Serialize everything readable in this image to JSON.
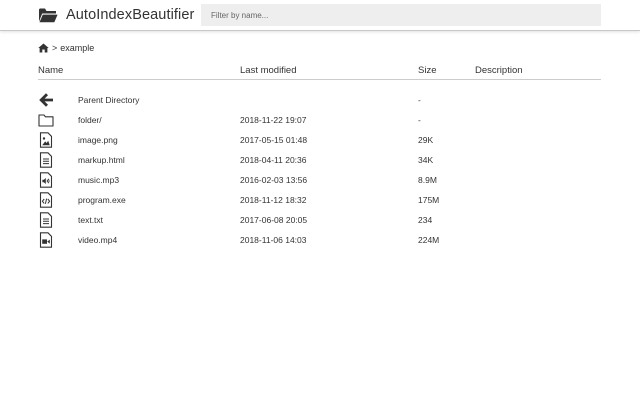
{
  "app": {
    "title": "AutoIndexBeautifier",
    "icon": "folder-open-icon"
  },
  "search": {
    "placeholder": "Filter by name..."
  },
  "breadcrumb": {
    "home_icon": "home-icon",
    "separator": ">",
    "current": "example"
  },
  "table": {
    "headers": {
      "name": "Name",
      "modified": "Last modified",
      "size": "Size",
      "description": "Description"
    },
    "rows": [
      {
        "icon": "arrow-left-icon",
        "name": "Parent Directory",
        "modified": "",
        "size": "-",
        "description": ""
      },
      {
        "icon": "folder-icon",
        "name": "folder/",
        "modified": "2018-11-22 19:07",
        "size": "-",
        "description": ""
      },
      {
        "icon": "image-file-icon",
        "name": "image.png",
        "modified": "2017-05-15 01:48",
        "size": "29K",
        "description": ""
      },
      {
        "icon": "text-file-icon",
        "name": "markup.html",
        "modified": "2018-04-11 20:36",
        "size": "34K",
        "description": ""
      },
      {
        "icon": "audio-file-icon",
        "name": "music.mp3",
        "modified": "2016-02-03 13:56",
        "size": "8.9M",
        "description": ""
      },
      {
        "icon": "code-file-icon",
        "name": "program.exe",
        "modified": "2018-11-12 18:32",
        "size": "175M",
        "description": ""
      },
      {
        "icon": "text-file-icon",
        "name": "text.txt",
        "modified": "2017-06-08 20:05",
        "size": "234",
        "description": ""
      },
      {
        "icon": "video-file-icon",
        "name": "video.mp4",
        "modified": "2018-11-06 14:03",
        "size": "224M",
        "description": ""
      }
    ]
  },
  "colors": {
    "text": "#333333",
    "header_border": "#c8c8c8",
    "search_bg": "#eeeeee",
    "rule": "#cccccc"
  }
}
